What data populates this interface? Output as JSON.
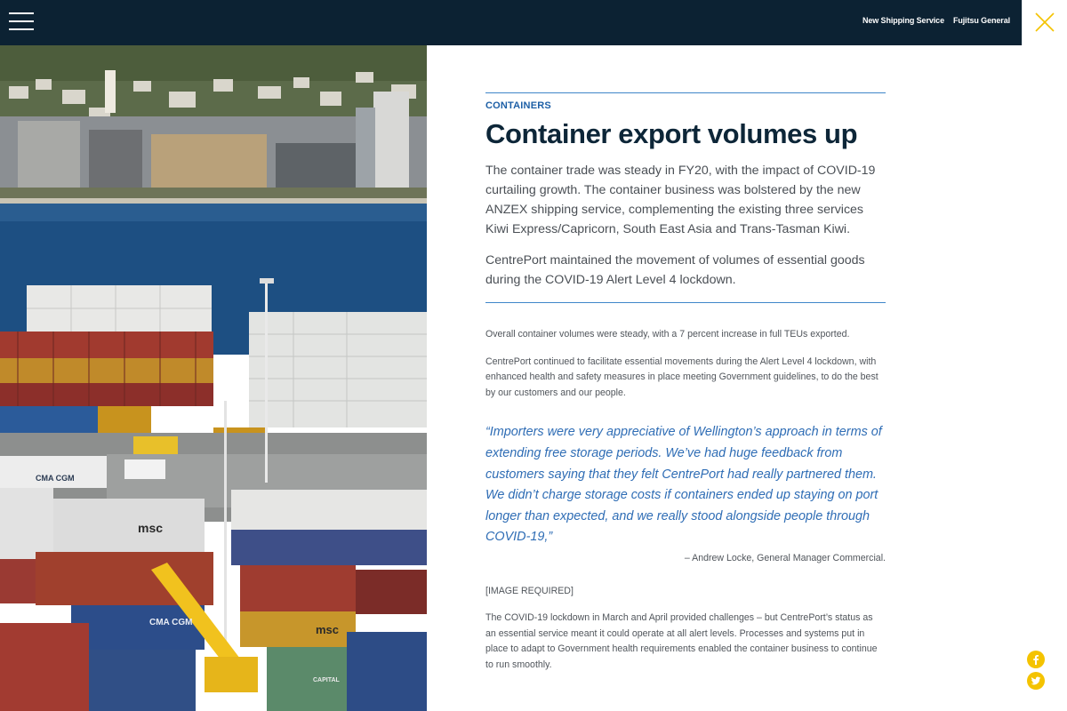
{
  "header": {
    "nav_links": [
      "New Shipping Service",
      "Fujitsu General"
    ],
    "close_label": "close"
  },
  "photo": {
    "container_brands": [
      "CMA CGM",
      "msc",
      "CMA CGM",
      "msc",
      "CAPITAL"
    ]
  },
  "article": {
    "kicker": "CONTAINERS",
    "headline": "Container export volumes up",
    "lede": [
      "The container trade was steady in FY20, with the impact of COVID-19 curtailing growth. The container business was bolstered by the new ANZEX shipping service, complementing the existing three services Kiwi Express/Capricorn, South East Asia and Trans-Tasman Kiwi.",
      "CentrePort maintained the movement of volumes of essential goods during the COVID-19 Alert Level 4 lockdown."
    ],
    "body": [
      "Overall container volumes were steady, with a 7 percent increase in full TEUs exported.",
      "CentrePort continued to facilitate essential movements during the Alert Level 4 lockdown, with enhanced health and safety measures in place meeting Government guidelines, to do the best by our customers and our people."
    ],
    "quote": "“Importers were very appreciative of Wellington’s approach in terms of extending free storage periods. We’ve had huge feedback from customers saying that they felt CentrePort had really partnered them. We didn’t charge storage costs if containers ended up staying on port longer than expected, and we really stood alongside people through COVID-19,”",
    "attribution": "– Andrew Locke, General Manager Commercial.",
    "image_placeholder": "[IMAGE REQUIRED]",
    "closing": "The COVID-19 lockdown in March and April provided challenges – but CentrePort’s status as an essential service meant it could operate at all alert levels. Processes and systems put in place to adapt to Government health requirements enabled the container business to continue to run smoothly."
  },
  "social": {
    "icons": [
      "facebook-icon",
      "twitter-icon"
    ]
  },
  "colors": {
    "topbar": "#0c2233",
    "accent_blue": "#1d5fa6",
    "quote_blue": "#2f6db5",
    "social_yellow": "#f4c300",
    "close_yellow": "#f4c300"
  }
}
